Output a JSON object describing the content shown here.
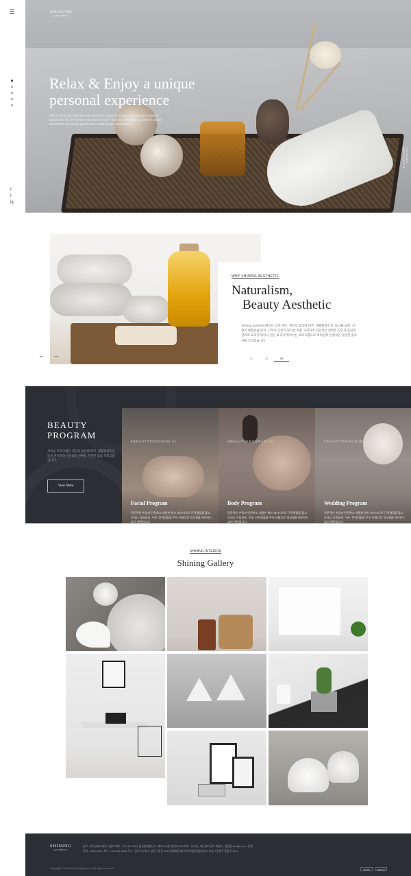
{
  "brand": {
    "name": "SHINING",
    "sub": "AESTHETIC"
  },
  "hero": {
    "title_line1": "Relax & Enjoy a unique",
    "title_line2": "personal experience",
    "lead": "This is the studio that we have learned through life in harmony with the universe, nature and it is this wisdom we want to share with you. We offer a variety of unique assortment of Shining goods and a relaxing spa experience.",
    "side_label": "SHINING AESTHETIC"
  },
  "rail": {
    "menu_icon": "hamburger-icon",
    "social": [
      "f",
      "t",
      "ig"
    ]
  },
  "about": {
    "eyebrow": "WHY SHINING AESTHETIC",
    "title_line1": "Naturalism,",
    "title_line2": "Beauty Aesthetic",
    "body": "Shining Aesthetic에서는 고객 개인, 개인의 몸상태 피부, 생활환경조건, 음식물 습관, 선천적 체질등을 분석, 고객의 단점과 원하는 바를 고려하여 전문적인 정확한 진단과 꼼꼼한 관리로 효과가 뛰어나 있는 효과가 뛰어나는 프로그램으로 여러분께 안정적인 유일한 솔루션을 드리겠습니다.",
    "tabs": [
      "01",
      "02",
      "03"
    ],
    "active_tab": 2,
    "prev": "←",
    "next": "→"
  },
  "program": {
    "title_line1": "BEAUTY",
    "title_line2": "PROGRAM",
    "desc": "샤이닝 프로그램은 개인의 몸상태 피부, 생활환경조건 등을 분석하여 전문적인 한편의 차별된 맞춤 프로그램입니다.",
    "view_more": "View More",
    "cards": [
      {
        "tag": "#BEAUTYPROGRAM 01",
        "title": "Facial Program",
        "desc": "전문적인 손길과 탄탄하고 세밀한 핸드 테크닉으로 근육결림을 풀고 모세나 자림세게, 수분, 탄력함을을 주어 아름다운 피부결을 케어하는 뷰티 케어입니다"
      },
      {
        "tag": "#BEAUTYPROGRAM 02",
        "title": "Body Program",
        "desc": "전문적인 손길과 탄탄하고 세밀한 핸드 테크닉으로 근육결림을 풀고 모세나 자림세게, 수분, 탄력함을을 주어 아름다운 피부결을 케어하는 뷰티 케어입니다"
      },
      {
        "tag": "#BEAUTYPROGRAM 03",
        "title": "Wedding Program",
        "desc": "전문적인 손길과 탄탄하고 세밀한 핸드 테크닉으로 근육결림을 풀고 모세나 자림세게, 수분, 탄력함을을 주어 아름다운 피부결을 케어하는 뷰티 케어입니다"
      }
    ]
  },
  "gallery": {
    "eyebrow": "SHINING INTERIOR",
    "title": "Shining Gallery",
    "items": [
      "candle-marble",
      "chair-interior",
      "white-room",
      "desk-workspace",
      "pendant-lamps",
      "cactus-pot",
      "frames-laptop",
      "white-candles"
    ]
  },
  "footer": {
    "info_line1": "상호 : 샤이닝에스테틱 사업자 번호 : 131-31-42918 통신판매업신고 : 제2019-경기부천-0248 대표 : 유샤인, 개인정보 관리 책임자 : 임원정 kaz@han.kr, 강재",
    "info_line2": "전화 : 1544-0034, 팩스 : 032-324-8062 주소 : 경기도 부천시 원미구 중동 1132 원봉빌딩9층 위프로발산영동대기5, 부천시 원미구 중동로 1044",
    "copyright": "Copyright © haz609.shiningcmy.com All rights reserved.",
    "btn1": "ADMIN",
    "btn2": "DESIGN"
  },
  "colors": {
    "dark_bg": "#2b2e33",
    "accent": "#222222"
  }
}
